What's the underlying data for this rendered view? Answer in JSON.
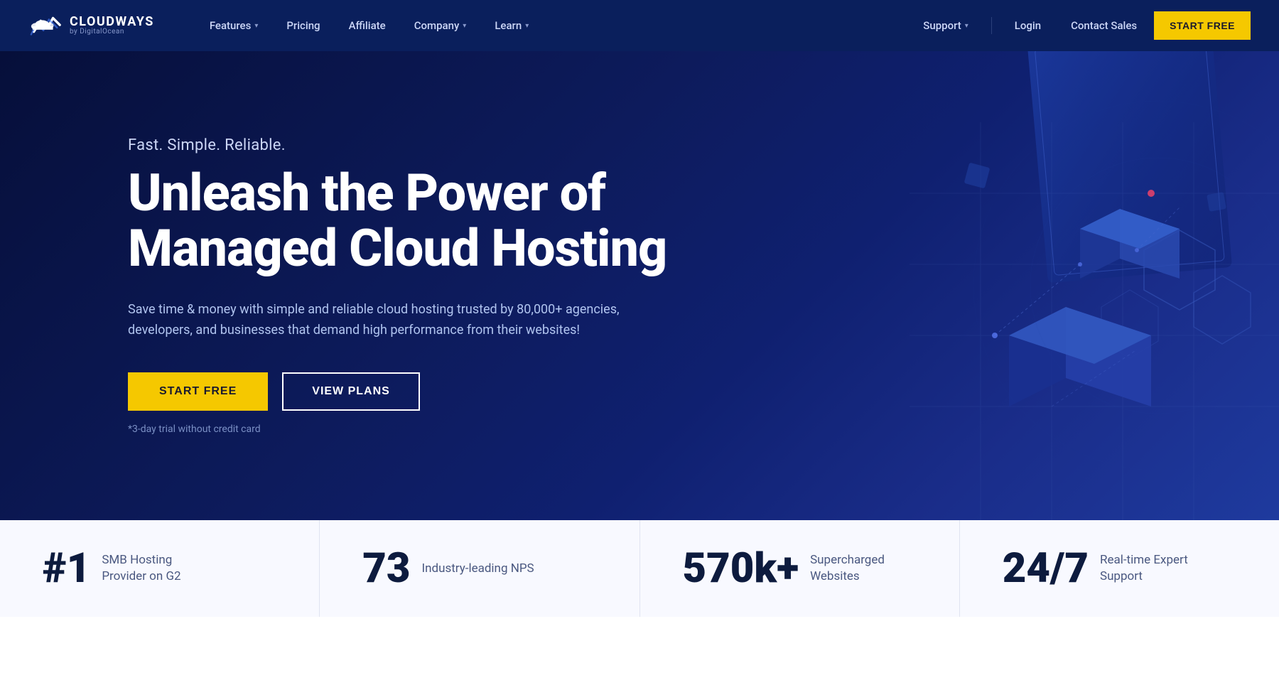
{
  "brand": {
    "name": "CLOUDWAYS",
    "sub": "by DigitalOcean"
  },
  "nav": {
    "features_label": "Features",
    "pricing_label": "Pricing",
    "affiliate_label": "Affiliate",
    "company_label": "Company",
    "learn_label": "Learn",
    "support_label": "Support",
    "login_label": "Login",
    "contact_label": "Contact Sales",
    "start_free_label": "START FREE"
  },
  "hero": {
    "tagline": "Fast. Simple. Reliable.",
    "title": "Unleash the Power of Managed Cloud Hosting",
    "description": "Save time & money with simple and reliable cloud hosting trusted by 80,000+ agencies, developers, and businesses that demand high performance from their websites!",
    "btn_start": "START FREE",
    "btn_plans": "VIEW PLANS",
    "disclaimer": "*3-day trial without credit card"
  },
  "stats": [
    {
      "number": "#1",
      "label": "SMB Hosting Provider on G2"
    },
    {
      "number": "73",
      "label": "Industry-leading NPS"
    },
    {
      "number": "570k+",
      "label": "Supercharged Websites"
    },
    {
      "number": "24/7",
      "label": "Real-time Expert Support"
    }
  ],
  "colors": {
    "nav_bg": "#0a1f5c",
    "hero_bg": "#060f3a",
    "accent_yellow": "#f5c800",
    "stats_bg": "#f8f9ff"
  }
}
